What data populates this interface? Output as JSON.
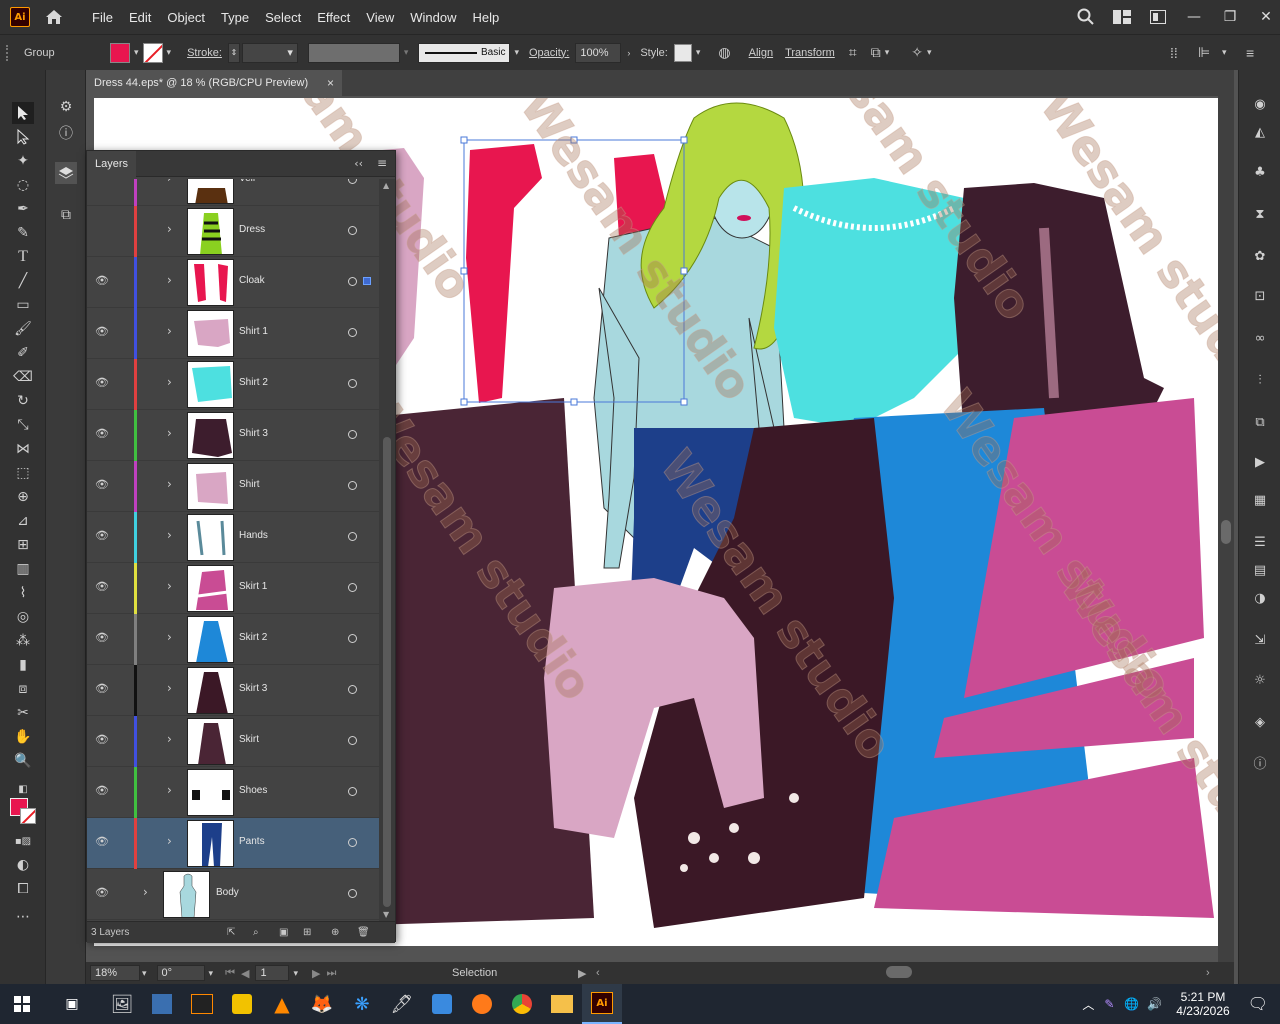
{
  "app": {
    "logo": "Ai",
    "menu": [
      "File",
      "Edit",
      "Object",
      "Type",
      "Select",
      "Effect",
      "View",
      "Window",
      "Help"
    ]
  },
  "control_bar": {
    "selection_type": "Group",
    "fill_color": "#e8164f",
    "stroke_label": "Stroke:",
    "stroke_style": "Basic",
    "opacity_label": "Opacity:",
    "opacity_value": "100%",
    "style_label": "Style:",
    "align_label": "Align",
    "transform_label": "Transform"
  },
  "document_tab": {
    "title": "Dress 44.eps* @ 18 % (RGB/CPU Preview)",
    "close": "×"
  },
  "layers_panel": {
    "title": "Layers",
    "layers": [
      {
        "name": "Veil",
        "color": "#c040c0",
        "thumb": "veil",
        "visible": false
      },
      {
        "name": "Dress",
        "color": "#e04040",
        "thumb": "dress",
        "visible": false
      },
      {
        "name": "Cloak",
        "color": "#4050e0",
        "thumb": "cloak",
        "visible": true,
        "selected_art": true
      },
      {
        "name": "Shirt 1",
        "color": "#4050e0",
        "thumb": "shirt1",
        "visible": true
      },
      {
        "name": "Shirt 2",
        "color": "#e04040",
        "thumb": "shirt2",
        "visible": true
      },
      {
        "name": "Shirt 3",
        "color": "#40c040",
        "thumb": "shirt3",
        "visible": true
      },
      {
        "name": "Shirt",
        "color": "#c040c0",
        "thumb": "shirt",
        "visible": true
      },
      {
        "name": "Hands",
        "color": "#40d0e0",
        "thumb": "hands",
        "visible": true
      },
      {
        "name": "Skirt 1",
        "color": "#e0e040",
        "thumb": "skirt1",
        "visible": true
      },
      {
        "name": "Skirt 2",
        "color": "#808080",
        "thumb": "skirt2",
        "visible": true
      },
      {
        "name": "Skirt 3",
        "color": "#111111",
        "thumb": "skirt3",
        "visible": true
      },
      {
        "name": "Skirt",
        "color": "#4050e0",
        "thumb": "skirt",
        "visible": true
      },
      {
        "name": "Shoes",
        "color": "#40c040",
        "thumb": "shoes",
        "visible": true
      },
      {
        "name": "Pants",
        "color": "#e04040",
        "thumb": "pants",
        "visible": true,
        "selected": true
      },
      {
        "name": "Body",
        "color": "#4050e0",
        "thumb": "body",
        "visible": true
      }
    ],
    "footer": "3 Layers"
  },
  "status_bar": {
    "zoom": "18%",
    "rotation": "0°",
    "artboard": "1",
    "tool": "Selection"
  },
  "watermark": "Wesam studio",
  "taskbar": {
    "time": "5:21 PM",
    "date": "4/23/2026"
  }
}
